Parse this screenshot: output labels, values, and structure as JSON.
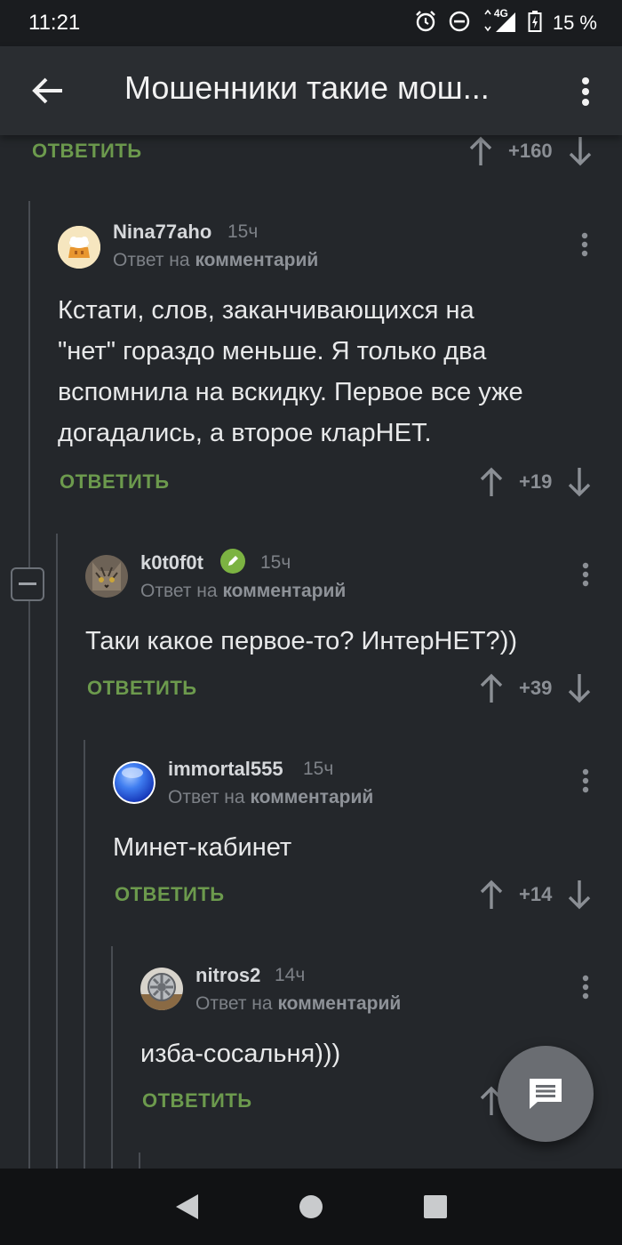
{
  "status_bar": {
    "time": "11:21",
    "network": "4G",
    "battery": "15 %"
  },
  "app_bar": {
    "title": "Мошенники такие мош..."
  },
  "top_item": {
    "reply_label": "ОТВЕТИТЬ",
    "score": "+160"
  },
  "comments": [
    {
      "author": "Nina77aho",
      "time": "15ч",
      "reply_prefix": "Ответ на",
      "reply_target": "комментарий",
      "lines": [
        "Кстати, слов, заканчивающихся на",
        "\"нет\" гораздо меньше. Я только два",
        "вспомнила на вскидку. Первое все уже",
        "догадались, а второе кларНЕТ."
      ],
      "reply_label": "ОТВЕТИТЬ",
      "score": "+19"
    },
    {
      "author": "k0t0f0t",
      "time": "15ч",
      "reply_prefix": "Ответ на",
      "reply_target": "комментарий",
      "lines": [
        "Таки какое первое-то? ИнтерНЕТ?))"
      ],
      "reply_label": "ОТВЕТИТЬ",
      "score": "+39"
    },
    {
      "author": "immortal555",
      "time": "15ч",
      "reply_prefix": "Ответ на",
      "reply_target": "комментарий",
      "lines": [
        "Минет-кабинет"
      ],
      "reply_label": "ОТВЕТИТЬ",
      "score": "+14"
    },
    {
      "author": "nitros2",
      "time": "14ч",
      "reply_prefix": "Ответ на",
      "reply_target": "комментарий",
      "lines": [
        "изба-сосальня)))"
      ],
      "reply_label": "ОТВЕТИТЬ"
    }
  ],
  "icons": {
    "back": "arrow-left-icon",
    "menu": "more-vert-icon",
    "upvote": "arrow-up-icon",
    "downvote": "arrow-down-icon",
    "collapse": "minus-icon",
    "fab": "comment-icon",
    "verified": "pencil-badge-icon"
  },
  "colors": {
    "reply_accent": "#6c9a4d",
    "verified_badge": "#7cb342",
    "background": "#24272b"
  }
}
